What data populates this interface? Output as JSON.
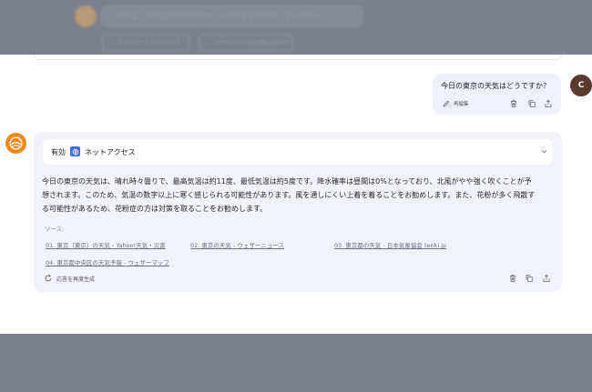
{
  "previous_message": {
    "text": "これ以上、He]@[w)(( ChatPh、いつでもぜひ質問してください。",
    "buttons": [
      "ウェブサイトについて",
      "サポートへのお問い合わせ"
    ]
  },
  "user_message": {
    "avatar_letter": "C",
    "text": "今日の東京の天気はどうですか？",
    "edit_label": "再編集"
  },
  "assistant_message": {
    "access_status": "有効",
    "access_label": "ネットアクセス",
    "answer_lines": [
      "今日の東京の天気は、晴れ時々曇りで、最高気温は約11度、最低気温は約5度です。降水確率は昼間は0%となっており、北風がやや強く吹くことが予",
      "想されます。このため、気温の数字以上に寒く感じられる可能性があります。風を通しにくい上着を着ることをお勧めします。また、花粉が多く飛散す",
      "る可能性があるため、花粉症の方は対策を取ることをお勧めします。"
    ],
    "sources_label": "ソース:",
    "sources": [
      "01. 東京（東京）の天気 - Yahoo!天気・災害",
      "02. 東京の天気 - ウェザーニュース",
      "03. 東京都の天気 - 日本気象協会 tenki.jp",
      "04. 東京都中央区の天気予報 - ウェザーマップ"
    ],
    "regenerate_label": "応答を再度生成"
  },
  "colors": {
    "overlay": "#7b7f8e",
    "user_bubble": "#eef0fb",
    "assistant_card": "#f2f3fa",
    "bot_avatar": "#f18a1a",
    "user_avatar": "#5a3a2c",
    "accent": "#4a6cf0"
  },
  "icons": [
    "edit-icon",
    "trash-icon",
    "copy-icon",
    "share-icon",
    "globe-icon",
    "chevron-down-icon",
    "refresh-icon",
    "bot-logo-icon"
  ]
}
